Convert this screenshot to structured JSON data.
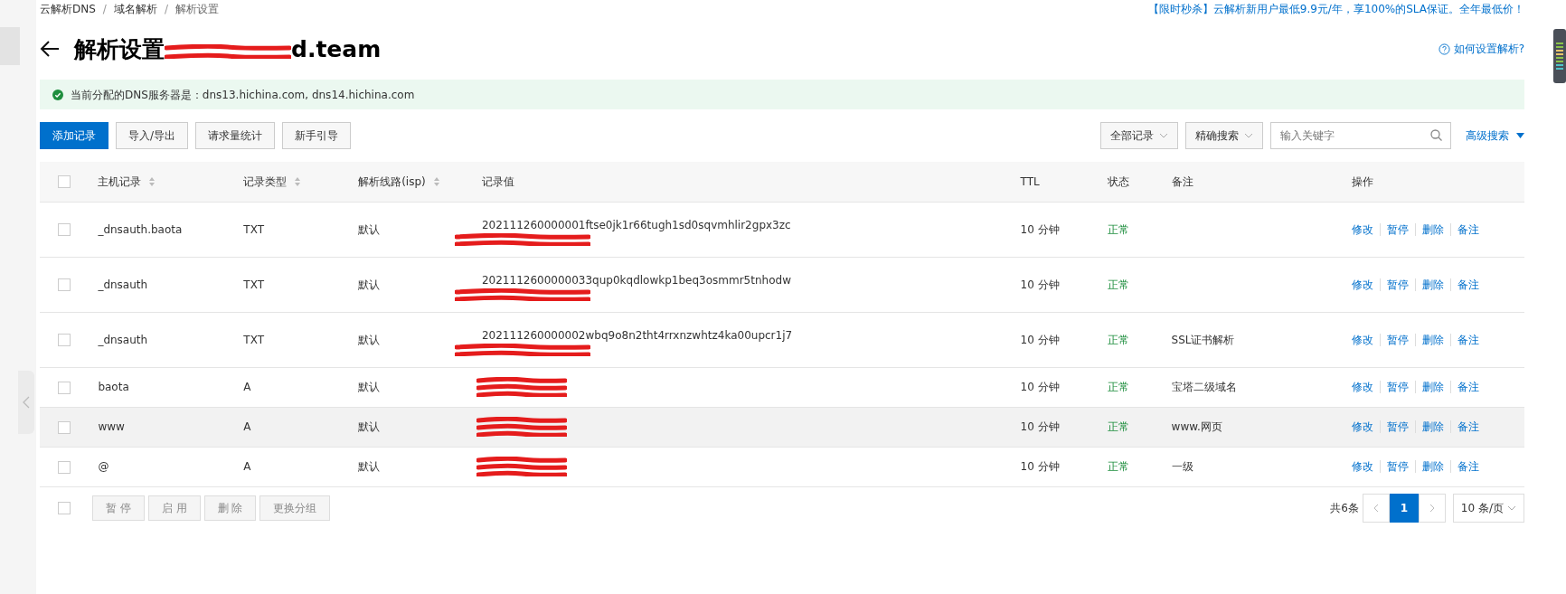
{
  "breadcrumb": [
    {
      "label": "云解析DNS"
    },
    {
      "label": "域名解析"
    },
    {
      "label": "解析设置"
    }
  ],
  "breadcrumb_separator": "/",
  "promo": "【限时秒杀】云解析新用户最低9.9元/年，享100%的SLA保证。全年最低价！",
  "title": {
    "prefix": "解析设置",
    "suffix": "d.team"
  },
  "help_link": "如何设置解析?",
  "notice": "当前分配的DNS服务器是：dns13.hichina.com, dns14.hichina.com",
  "toolbar": {
    "buttons": [
      {
        "label": "添加记录",
        "primary": true
      },
      {
        "label": "导入/导出",
        "primary": false
      },
      {
        "label": "请求量统计",
        "primary": false
      },
      {
        "label": "新手引导",
        "primary": false
      }
    ],
    "filter": "全部记录",
    "search_mode": "精确搜索",
    "search": {
      "placeholder": "输入关键字"
    },
    "advanced": "高级搜索"
  },
  "table": {
    "select_all_checked": false,
    "columns": [
      {
        "label": "主机记录",
        "sortable": true
      },
      {
        "label": "记录类型",
        "sortable": true
      },
      {
        "label": "解析线路(isp)",
        "sortable": true
      },
      {
        "label": "记录值",
        "sortable": false
      },
      {
        "label": "TTL",
        "sortable": false
      },
      {
        "label": "状态",
        "sortable": false
      },
      {
        "label": "备注",
        "sortable": false
      },
      {
        "label": "操作",
        "sortable": false
      }
    ],
    "rows": [
      {
        "checked": false,
        "host": "_dnsauth.baota",
        "type": "TXT",
        "line": "默认",
        "value": "202111260000001ftse0jk1r66tugh1sd0sqvmhlir2gpx3zc",
        "ttl": "10 分钟",
        "status": "正常",
        "remark": "",
        "actions": [
          "修改",
          "暂停",
          "删除",
          "备注"
        ],
        "hovered": false
      },
      {
        "checked": false,
        "host": "_dnsauth",
        "type": "TXT",
        "line": "默认",
        "value": "2021112600000033qup0kqdlowkp1beq3osmmr5tnhodw",
        "ttl": "10 分钟",
        "status": "正常",
        "remark": "",
        "actions": [
          "修改",
          "暂停",
          "删除",
          "备注"
        ],
        "hovered": false
      },
      {
        "checked": false,
        "host": "_dnsauth",
        "type": "TXT",
        "line": "默认",
        "value": "202111260000002wbq9o8n2tht4rrxnzwhtz4ka00upcr1j7",
        "ttl": "10 分钟",
        "status": "正常",
        "remark": "SSL证书解析",
        "actions": [
          "修改",
          "暂停",
          "删除",
          "备注"
        ],
        "hovered": false
      },
      {
        "checked": false,
        "host": "baota",
        "type": "A",
        "line": "默认",
        "value": "",
        "ttl": "10 分钟",
        "status": "正常",
        "remark": "宝塔二级域名",
        "actions": [
          "修改",
          "暂停",
          "删除",
          "备注"
        ],
        "hovered": false
      },
      {
        "checked": false,
        "host": "www",
        "type": "A",
        "line": "默认",
        "value": "",
        "ttl": "10 分钟",
        "status": "正常",
        "remark": "www.网页",
        "actions": [
          "修改",
          "暂停",
          "删除",
          "备注"
        ],
        "hovered": true
      },
      {
        "checked": false,
        "host": "@",
        "type": "A",
        "line": "默认",
        "value": "",
        "ttl": "10 分钟",
        "status": "正常",
        "remark": "一级",
        "actions": [
          "修改",
          "暂停",
          "删除",
          "备注"
        ],
        "hovered": false
      }
    ]
  },
  "bulk_select_checked": false,
  "bulk_buttons": [
    {
      "label": "暂 停",
      "disabled": true
    },
    {
      "label": "启 用",
      "disabled": true
    },
    {
      "label": "删 除",
      "disabled": true
    },
    {
      "label": "更换分组",
      "disabled": true
    }
  ],
  "pagination": {
    "total": "共6条",
    "pages": [
      {
        "label": "1",
        "selected": true
      }
    ],
    "page_size": "10 条/页"
  }
}
